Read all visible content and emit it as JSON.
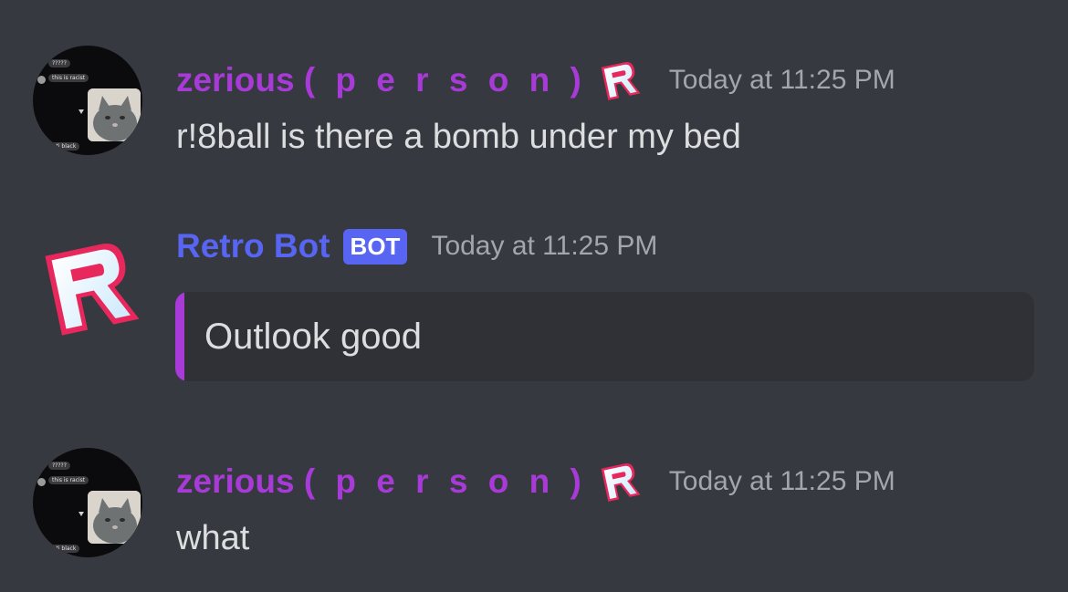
{
  "messages": [
    {
      "author": {
        "name_prefix": "zerious",
        "name_spaced": "( p e r s o n )",
        "badge_icon": "roblox-r-icon",
        "color": "#a83ad8"
      },
      "timestamp": "Today at 11:25 PM",
      "text": "r!8ball is there a bomb under my bed",
      "avatar": {
        "pill_top": "?????",
        "pill_mid": "this is racist",
        "pill_bottom": "anti black"
      }
    },
    {
      "author": {
        "name": "Retro Bot",
        "tag": "BOT",
        "color": "#5865f2",
        "avatar_icon": "roblox-r-icon"
      },
      "timestamp": "Today at 11:25 PM",
      "embed": {
        "text": "Outlook good",
        "accent_color": "#a83ad8"
      }
    },
    {
      "author": {
        "name_prefix": "zerious",
        "name_spaced": "( p e r s o n )",
        "badge_icon": "roblox-r-icon",
        "color": "#a83ad8"
      },
      "timestamp": "Today at 11:25 PM",
      "text": "what",
      "avatar": {
        "pill_top": "?????",
        "pill_mid": "this is racist",
        "pill_bottom": "anti black"
      }
    }
  ],
  "theme": {
    "background": "#36393f",
    "embed_background": "#2f3136",
    "text_color": "#dcddde",
    "timestamp_color": "#a3a6aa"
  }
}
